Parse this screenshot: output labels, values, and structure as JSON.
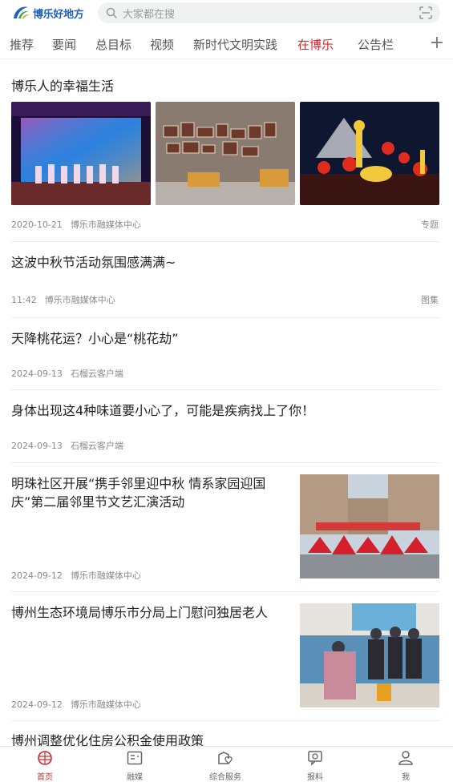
{
  "header": {
    "logo_text": "博乐好地方",
    "search_placeholder": "大家都在搜"
  },
  "tabs": [
    {
      "label": "推荐"
    },
    {
      "label": "要闻"
    },
    {
      "label": "总目标"
    },
    {
      "label": "视频"
    },
    {
      "label": "新时代文明实践"
    },
    {
      "label": "在博乐",
      "active": true
    },
    {
      "label": "公告栏"
    }
  ],
  "feed": {
    "featured": {
      "title": "博乐人的幸福生活",
      "date": "2020-10-21",
      "source": "博乐市融媒体中心",
      "tag": "专题"
    },
    "items": [
      {
        "title": "这波中秋节活动氛围感满满~",
        "date": "11:42",
        "source": "博乐市融媒体中心",
        "tag": "图集"
      },
      {
        "title": "天降桃花运？小心是“桃花劫”",
        "date": "2024-09-13",
        "source": "石榴云客户端"
      },
      {
        "title": "身体出现这4种味道要小心了，可能是疾病找上了你！",
        "date": "2024-09-13",
        "source": "石榴云客户端"
      },
      {
        "title_line1": "明珠社区开展“携手邻里迎中秋 情系家园迎国",
        "title_line2": "庆”第二届邻里节文艺汇演活动",
        "date": "2024-09-12",
        "source": "博乐市融媒体中心"
      },
      {
        "title": "博州生态环境局博乐市分局上门慰问独居老人",
        "date": "2024-09-12",
        "source": "博乐市融媒体中心"
      },
      {
        "title": "博州调整优化住房公积金使用政策"
      }
    ]
  },
  "bottom_nav": [
    {
      "label": "首页",
      "icon": "home-icon",
      "active": true
    },
    {
      "label": "融媒",
      "icon": "media-icon"
    },
    {
      "label": "综合服务",
      "icon": "services-icon"
    },
    {
      "label": "报料",
      "icon": "report-icon"
    },
    {
      "label": "我",
      "icon": "profile-icon"
    }
  ],
  "colors": {
    "accent": "#d6262e",
    "logo_blue": "#1f5fb8",
    "meta_gray": "#8a8a8a"
  }
}
